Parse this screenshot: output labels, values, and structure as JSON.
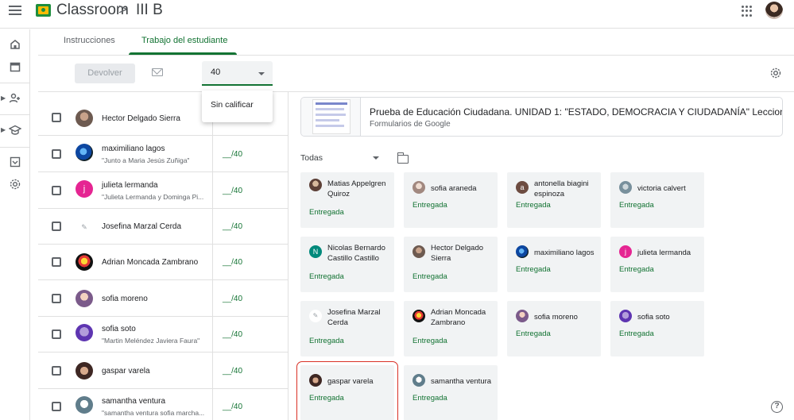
{
  "header": {
    "app_title": "Classroom",
    "breadcrumb_separator": ">",
    "class_name": "III B",
    "icons": [
      "menu-icon",
      "classroom-logo-icon",
      "apps-grid-icon",
      "user-avatar"
    ]
  },
  "rail": {
    "icons": [
      "home-icon",
      "calendar-icon",
      "people-icon",
      "school-icon",
      "archive-icon",
      "settings-icon"
    ]
  },
  "tabs": [
    {
      "label": "Instrucciones",
      "active": false
    },
    {
      "label": "Trabajo del estudiante",
      "active": true
    }
  ],
  "toolbar": {
    "return_label": "Devolver",
    "points_value": "40",
    "dropdown_option": "Sin calificar"
  },
  "students": [
    {
      "name": "Hector Delgado Sierra",
      "subtitle": "",
      "grade": ""
    },
    {
      "name": "maximiliano lagos",
      "subtitle": "\"Junto a Maria Jesús Zuñiga\"",
      "grade": "__/40"
    },
    {
      "name": "julieta lermanda",
      "subtitle": "\"Julieta Lermanda y Dominga Pi...",
      "grade": "__/40"
    },
    {
      "name": "Josefina Marzal Cerda",
      "subtitle": "",
      "grade": "__/40"
    },
    {
      "name": "Adrian Moncada Zambrano",
      "subtitle": "",
      "grade": "__/40"
    },
    {
      "name": "sofia moreno",
      "subtitle": "",
      "grade": "__/40"
    },
    {
      "name": "sofia soto",
      "subtitle": "\"Martin Meléndez Javiera Faura\"",
      "grade": "__/40"
    },
    {
      "name": "gaspar varela",
      "subtitle": "",
      "grade": "__/40"
    },
    {
      "name": "samantha ventura",
      "subtitle": "\"samantha ventura sofia marcha...",
      "grade": "__/40"
    }
  ],
  "assignment": {
    "title": "Prueba de Educación Ciudadana. UNIDAD 1: \"ESTADO, DEMOCRACIA Y CIUDADANÍA\" Leccion...",
    "subtitle": "Formularios de Google"
  },
  "filter": {
    "label": "Todas"
  },
  "submissions": [
    {
      "name": "Matias Appelgren Quiroz",
      "status": "Entregada",
      "avatar_color": "#6d4c41"
    },
    {
      "name": "sofia araneda",
      "status": "Entregada",
      "avatar_color": "#d7ccc8"
    },
    {
      "name": "antonella biagini espinoza",
      "status": "Entregada",
      "avatar_color": "#6d4c41",
      "initial": "a"
    },
    {
      "name": "victoria calvert",
      "status": "Entregada",
      "avatar_color": "#78909c"
    },
    {
      "name": "Nicolas Bernardo Castillo Castillo",
      "status": "Entregada",
      "avatar_color": "#00897b",
      "initial": "N"
    },
    {
      "name": "Hector Delgado Sierra",
      "status": "Entregada",
      "avatar_color": "#8d6e63"
    },
    {
      "name": "maximiliano lagos",
      "status": "Entregada",
      "avatar_color": "#1565c0"
    },
    {
      "name": "julieta lermanda",
      "status": "Entregada",
      "avatar_color": "#e52592",
      "initial": "j"
    },
    {
      "name": "Josefina Marzal Cerda",
      "status": "Entregada",
      "avatar_color": "#eceff1"
    },
    {
      "name": "Adrian Moncada Zambrano",
      "status": "Entregada",
      "avatar_color": "#f9a825"
    },
    {
      "name": "sofia moreno",
      "status": "Entregada",
      "avatar_color": "#9575cd"
    },
    {
      "name": "sofia soto",
      "status": "Entregada",
      "avatar_color": "#7e57c2"
    },
    {
      "name": "gaspar varela",
      "status": "Entregada",
      "avatar_color": "#5d4037",
      "selected": true
    },
    {
      "name": "samantha ventura",
      "status": "Entregada",
      "avatar_color": "#90a4ae"
    }
  ],
  "colors": {
    "accent": "#137333",
    "selection": "#d93025"
  },
  "help": "?"
}
